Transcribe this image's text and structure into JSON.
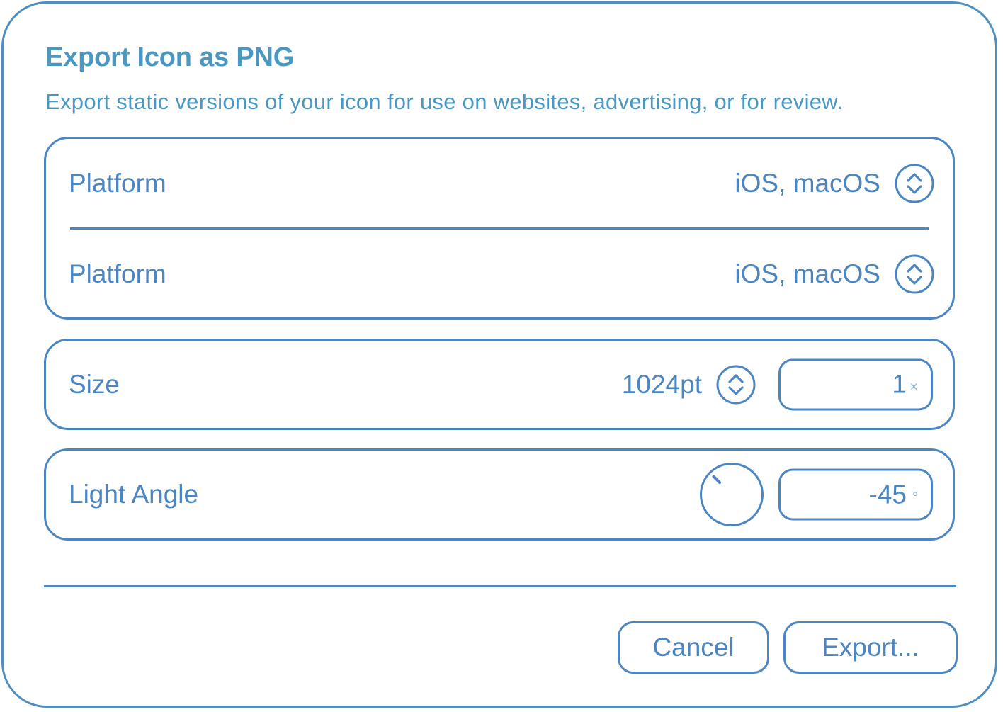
{
  "dialog": {
    "title": "Export Icon as PNG",
    "subtitle": "Export static versions of your icon for use on websites, advertising, or for review."
  },
  "platform_rows": [
    {
      "label": "Platform",
      "value": "iOS, macOS",
      "icon": "stepper-updown-icon"
    },
    {
      "label": "Platform",
      "value": "iOS, macOS",
      "icon": "stepper-updown-icon"
    }
  ],
  "size_row": {
    "label": "Size",
    "value": "1024pt",
    "icon": "stepper-updown-icon",
    "scale_value": "1",
    "scale_unit": "×"
  },
  "light_row": {
    "label": "Light Angle",
    "dial_icon": "angle-dial-icon",
    "angle_value": "-45",
    "angle_unit": "°",
    "angle_degrees": -45
  },
  "buttons": {
    "cancel": "Cancel",
    "export": "Export..."
  },
  "colors": {
    "accent": "#4c86c2",
    "title": "#4a97c1",
    "unit": "#8bb0d3"
  }
}
